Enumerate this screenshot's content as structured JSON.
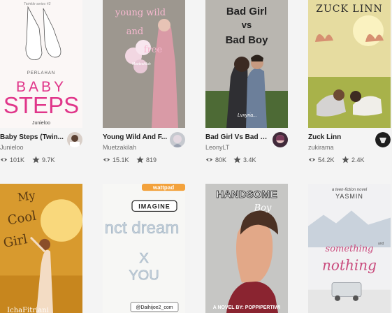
{
  "books": [
    {
      "title": "Baby Steps (Twin...",
      "author": "Junieloo",
      "reads": "101K",
      "votes": "9.7K",
      "cover": {
        "series": "Twinkle series #3",
        "top": "PERLAHAN",
        "title_line1": "BABY",
        "title_line2": "STEPS",
        "bottom": "Junieloo"
      }
    },
    {
      "title": "Young Wild And F...",
      "author": "Muetzakilah",
      "reads": "15.1K",
      "votes": "819",
      "cover": {
        "line1": "young wild",
        "line2": "and",
        "line3": "free",
        "sub": "Muetzakilah"
      }
    },
    {
      "title": "Bad Girl Vs Bad Boy",
      "author": "LeonyLT",
      "reads": "80K",
      "votes": "3.4K",
      "cover": {
        "line1": "Bad Girl",
        "line2": "vs",
        "line3": "Bad Boy",
        "sub": "Lvxyria..."
      }
    },
    {
      "title": "Zuck Linn",
      "author": "zukirama",
      "reads": "54.2K",
      "votes": "2.4K",
      "cover": {
        "title": "ZUCK LINN"
      }
    },
    {
      "cover": {
        "line1": "My",
        "line2": "Cool",
        "line3": "Girl",
        "bottom": "IchaFitriani"
      }
    },
    {
      "cover": {
        "badge": "wattpad",
        "box": "IMAGINE",
        "line1": "nct dream",
        "line2": "X",
        "line3": "YOU",
        "handle": "@Daihijoe2_com"
      }
    },
    {
      "cover": {
        "line1": "HANDSOME",
        "line2": "Boy",
        "bottom": "A NOVEL BY: POPPIPERTIWI"
      }
    },
    {
      "cover": {
        "top": "a teen-fiction novel",
        "author": "YASMIN",
        "line1": "something",
        "line2": "nothing",
        "small": "and"
      }
    }
  ],
  "colors": {
    "background": "#f4f4f4",
    "title": "#222222",
    "author": "#6f6f6f",
    "pink": "#e0368a"
  }
}
